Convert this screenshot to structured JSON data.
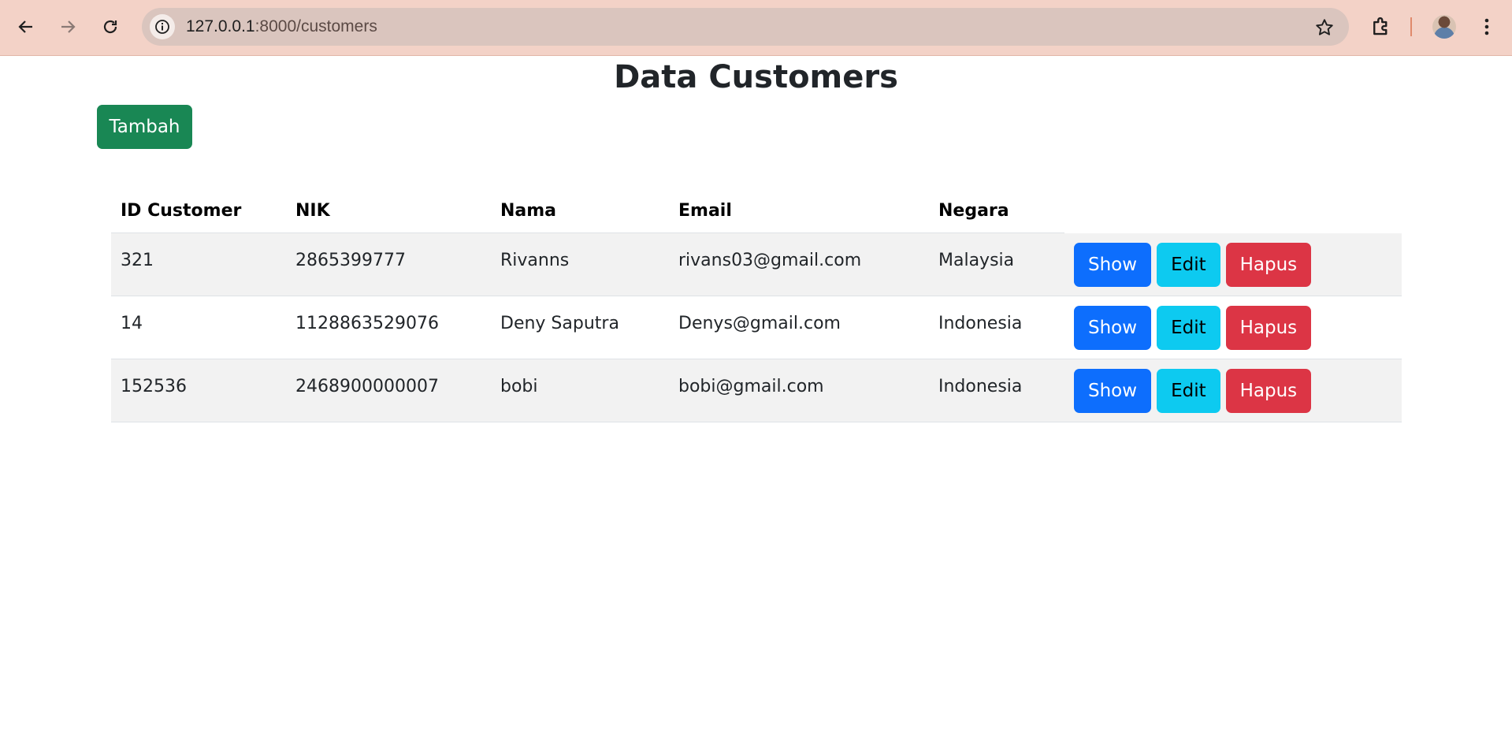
{
  "browser": {
    "url_host": "127.0.0.1",
    "url_path": ":8000/customers"
  },
  "page": {
    "title": "Data Customers",
    "add_button": "Tambah"
  },
  "table": {
    "headers": [
      "ID Customer",
      "NIK",
      "Nama",
      "Email",
      "Negara"
    ],
    "rows": [
      {
        "id": "321",
        "nik": "2865399777",
        "nama": "Rivanns",
        "email": "rivans03@gmail.com",
        "negara": "Malaysia"
      },
      {
        "id": "14",
        "nik": "1128863529076",
        "nama": "Deny Saputra",
        "email": "Denys@gmail.com",
        "negara": "Indonesia"
      },
      {
        "id": "152536",
        "nik": "2468900000007",
        "nama": "bobi",
        "email": "bobi@gmail.com",
        "negara": "Indonesia"
      }
    ],
    "actions": {
      "show": "Show",
      "edit": "Edit",
      "delete": "Hapus"
    }
  },
  "colors": {
    "success": "#198754",
    "primary": "#0d6efd",
    "info": "#0dcaf0",
    "danger": "#dc3545",
    "chrome": "#f3d2c7"
  }
}
